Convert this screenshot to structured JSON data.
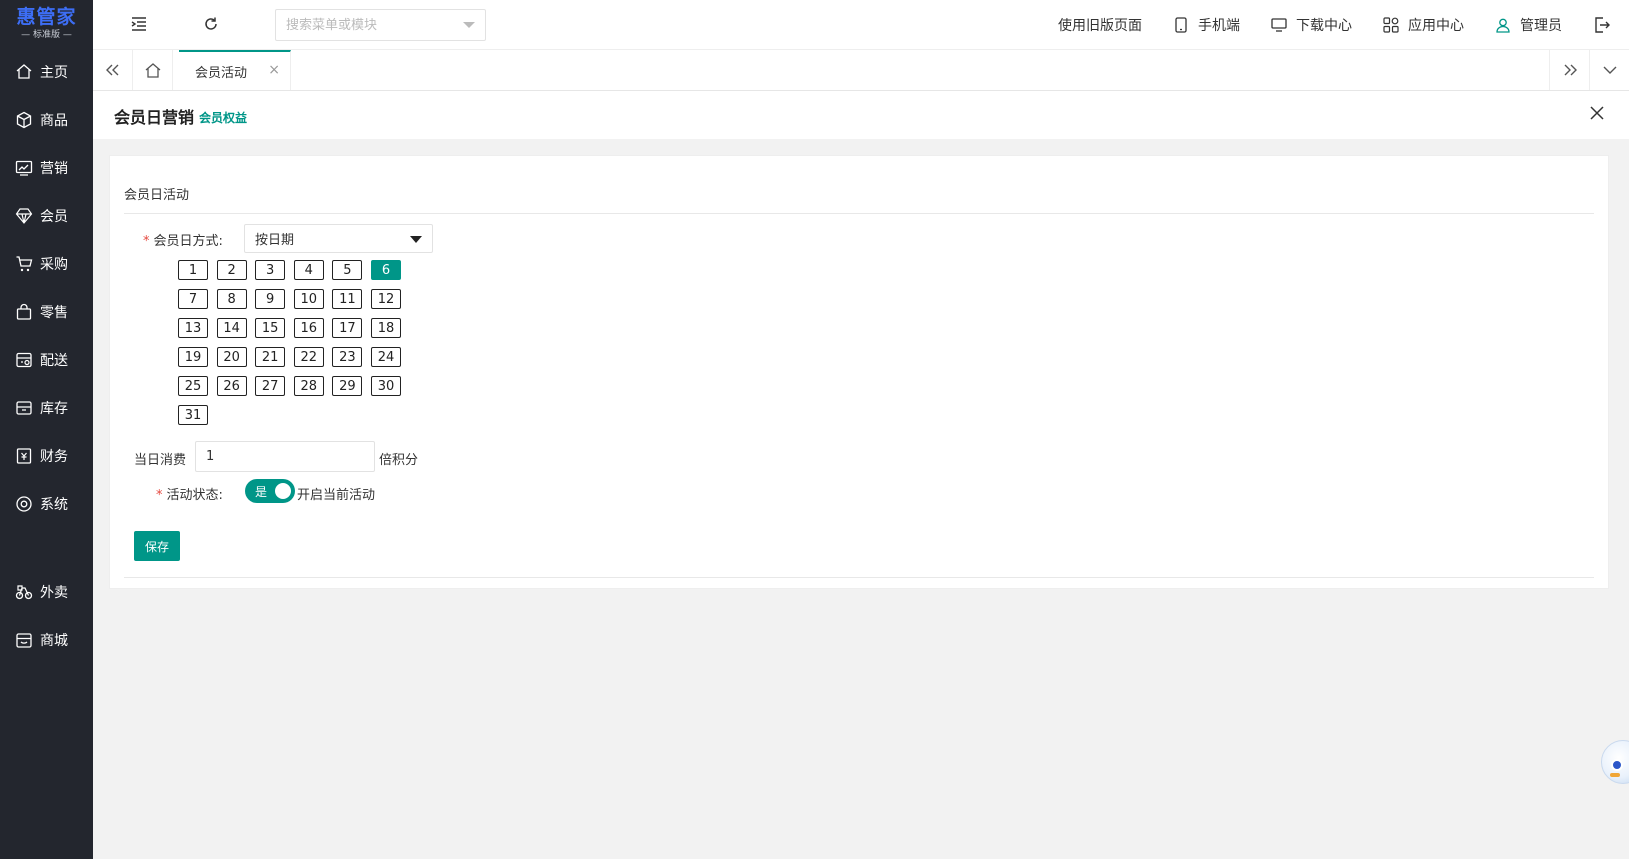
{
  "app": {
    "logo_main": "惠管家",
    "logo_sub": "— 标准版 —"
  },
  "sidebar": {
    "items": [
      {
        "label": "主页",
        "icon": "home-icon"
      },
      {
        "label": "商品",
        "icon": "cube-icon"
      },
      {
        "label": "营销",
        "icon": "chart-icon"
      },
      {
        "label": "会员",
        "icon": "diamond-icon"
      },
      {
        "label": "采购",
        "icon": "cart-icon"
      },
      {
        "label": "零售",
        "icon": "bag-icon"
      },
      {
        "label": "配送",
        "icon": "delivery-icon"
      },
      {
        "label": "库存",
        "icon": "inbox-icon"
      },
      {
        "label": "财务",
        "icon": "finance-icon"
      },
      {
        "label": "系统",
        "icon": "settings-icon"
      }
    ],
    "extra_items": [
      {
        "label": "外卖",
        "icon": "bike-icon"
      },
      {
        "label": "商城",
        "icon": "store-icon"
      }
    ]
  },
  "header": {
    "search_placeholder": "搜索菜单或模块",
    "old_page": "使用旧版页面",
    "mobile": "手机端",
    "download": "下载中心",
    "apps": "应用中心",
    "user": "管理员"
  },
  "tabs": {
    "active": "会员活动",
    "close_glyph": "×"
  },
  "page": {
    "title": "会员日营销",
    "subtitle": "会员权益"
  },
  "form": {
    "section_title": "会员日活动",
    "required_mark": "*",
    "mode_label": "会员日方式:",
    "mode_value": "按日期",
    "days": [
      "1",
      "2",
      "3",
      "4",
      "5",
      "6",
      "7",
      "8",
      "9",
      "10",
      "11",
      "12",
      "13",
      "14",
      "15",
      "16",
      "17",
      "18",
      "19",
      "20",
      "21",
      "22",
      "23",
      "24",
      "25",
      "26",
      "27",
      "28",
      "29",
      "30",
      "31"
    ],
    "selected_day": "6",
    "consume_label": "当日消费",
    "consume_value": "1",
    "consume_suffix": "倍积分",
    "status_label": "活动状态:",
    "status_switch_text": "是",
    "status_on": true,
    "status_desc": "开启当前活动",
    "save_label": "保存"
  },
  "colors": {
    "sidebar_bg": "#23262e",
    "accent": "#009688",
    "logo": "#3d6ef5",
    "required": "#e5483f"
  }
}
